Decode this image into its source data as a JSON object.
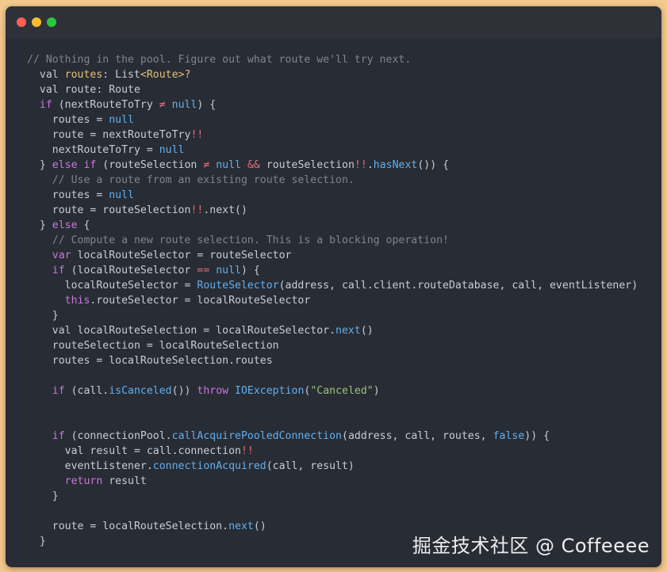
{
  "colors": {
    "page_background": "#f4c98d",
    "window_background": "#282c34",
    "titlebar_background": "#2e3238",
    "traffic_red": "#ff5f57",
    "traffic_yellow": "#febc2e",
    "traffic_green": "#28c840",
    "comment": "#7f848e",
    "keyword": "#c678dd",
    "type": "#e5c07b",
    "literal": "#61afef",
    "operator": "#e06c75",
    "function": "#61afef",
    "string": "#98c379",
    "plain": "#c8ccd4"
  },
  "window": {
    "traffic_lights": [
      {
        "name": "close",
        "color": "#ff5f57"
      },
      {
        "name": "minimize",
        "color": "#febc2e"
      },
      {
        "name": "zoom",
        "color": "#28c840"
      }
    ]
  },
  "code": {
    "lines": [
      [
        {
          "t": "comment",
          "v": "// Nothing in the pool. Figure out what route we'll try next."
        }
      ],
      [
        {
          "t": "plain",
          "v": "  val "
        },
        {
          "t": "type",
          "v": "routes"
        },
        {
          "t": "plain",
          "v": ": List"
        },
        {
          "t": "type",
          "v": "<Route>?"
        }
      ],
      [
        {
          "t": "plain",
          "v": "  val route: Route"
        }
      ],
      [
        {
          "t": "keyword",
          "v": "  if"
        },
        {
          "t": "plain",
          "v": " (nextRouteToTry "
        },
        {
          "t": "operator",
          "v": "≠"
        },
        {
          "t": "plain",
          "v": " "
        },
        {
          "t": "literal",
          "v": "null"
        },
        {
          "t": "plain",
          "v": ") {"
        }
      ],
      [
        {
          "t": "plain",
          "v": "    routes = "
        },
        {
          "t": "literal",
          "v": "null"
        }
      ],
      [
        {
          "t": "plain",
          "v": "    route = nextRouteToTry"
        },
        {
          "t": "operator",
          "v": "!!"
        }
      ],
      [
        {
          "t": "plain",
          "v": "    nextRouteToTry = "
        },
        {
          "t": "literal",
          "v": "null"
        }
      ],
      [
        {
          "t": "plain",
          "v": "  } "
        },
        {
          "t": "keyword",
          "v": "else if"
        },
        {
          "t": "plain",
          "v": " (routeSelection "
        },
        {
          "t": "operator",
          "v": "≠"
        },
        {
          "t": "plain",
          "v": " "
        },
        {
          "t": "literal",
          "v": "null"
        },
        {
          "t": "plain",
          "v": " "
        },
        {
          "t": "operator",
          "v": "&&"
        },
        {
          "t": "plain",
          "v": " routeSelection"
        },
        {
          "t": "operator",
          "v": "!!"
        },
        {
          "t": "plain",
          "v": "."
        },
        {
          "t": "function",
          "v": "hasNext"
        },
        {
          "t": "plain",
          "v": "()) {"
        }
      ],
      [
        {
          "t": "comment",
          "v": "    // Use a route from an existing route selection."
        }
      ],
      [
        {
          "t": "plain",
          "v": "    routes = "
        },
        {
          "t": "literal",
          "v": "null"
        }
      ],
      [
        {
          "t": "plain",
          "v": "    route = routeSelection"
        },
        {
          "t": "operator",
          "v": "!!"
        },
        {
          "t": "plain",
          "v": ".next()"
        }
      ],
      [
        {
          "t": "plain",
          "v": "  } "
        },
        {
          "t": "keyword",
          "v": "else"
        },
        {
          "t": "plain",
          "v": " {"
        }
      ],
      [
        {
          "t": "comment",
          "v": "    // Compute a new route selection. This is a blocking operation!"
        }
      ],
      [
        {
          "t": "keyword",
          "v": "    var"
        },
        {
          "t": "plain",
          "v": " localRouteSelector = routeSelector"
        }
      ],
      [
        {
          "t": "keyword",
          "v": "    if"
        },
        {
          "t": "plain",
          "v": " (localRouteSelector "
        },
        {
          "t": "operator",
          "v": "=="
        },
        {
          "t": "plain",
          "v": " "
        },
        {
          "t": "literal",
          "v": "null"
        },
        {
          "t": "plain",
          "v": ") {"
        }
      ],
      [
        {
          "t": "plain",
          "v": "      localRouteSelector = "
        },
        {
          "t": "function",
          "v": "RouteSelector"
        },
        {
          "t": "plain",
          "v": "(address, call.client.routeDatabase, call, eventListener)"
        }
      ],
      [
        {
          "t": "keyword",
          "v": "      this"
        },
        {
          "t": "plain",
          "v": ".routeSelector = localRouteSelector"
        }
      ],
      [
        {
          "t": "plain",
          "v": "    }"
        }
      ],
      [
        {
          "t": "plain",
          "v": "    val localRouteSelection = localRouteSelector."
        },
        {
          "t": "function",
          "v": "next"
        },
        {
          "t": "plain",
          "v": "()"
        }
      ],
      [
        {
          "t": "plain",
          "v": "    routeSelection = localRouteSelection"
        }
      ],
      [
        {
          "t": "plain",
          "v": "    routes = localRouteSelection.routes"
        }
      ],
      [],
      [
        {
          "t": "keyword",
          "v": "    if"
        },
        {
          "t": "plain",
          "v": " (call."
        },
        {
          "t": "function",
          "v": "isCanceled"
        },
        {
          "t": "plain",
          "v": "()) "
        },
        {
          "t": "keyword",
          "v": "throw"
        },
        {
          "t": "plain",
          "v": " "
        },
        {
          "t": "function",
          "v": "IOException"
        },
        {
          "t": "plain",
          "v": "("
        },
        {
          "t": "string",
          "v": "\"Canceled\""
        },
        {
          "t": "plain",
          "v": ")"
        }
      ],
      [],
      [],
      [
        {
          "t": "keyword",
          "v": "    if"
        },
        {
          "t": "plain",
          "v": " (connectionPool."
        },
        {
          "t": "function",
          "v": "callAcquirePooledConnection"
        },
        {
          "t": "plain",
          "v": "(address, call, routes, "
        },
        {
          "t": "literal",
          "v": "false"
        },
        {
          "t": "plain",
          "v": ")) {"
        }
      ],
      [
        {
          "t": "plain",
          "v": "      val result = call.connection"
        },
        {
          "t": "operator",
          "v": "!!"
        }
      ],
      [
        {
          "t": "plain",
          "v": "      eventListener."
        },
        {
          "t": "function",
          "v": "connectionAcquired"
        },
        {
          "t": "plain",
          "v": "(call, result)"
        }
      ],
      [
        {
          "t": "keyword",
          "v": "      return"
        },
        {
          "t": "plain",
          "v": " result"
        }
      ],
      [
        {
          "t": "plain",
          "v": "    }"
        }
      ],
      [],
      [
        {
          "t": "plain",
          "v": "    route = localRouteSelection."
        },
        {
          "t": "function",
          "v": "next"
        },
        {
          "t": "plain",
          "v": "()"
        }
      ],
      [
        {
          "t": "plain",
          "v": "  }"
        }
      ]
    ]
  },
  "watermark": {
    "text": "掘金技术社区 @ Coffeeee"
  }
}
